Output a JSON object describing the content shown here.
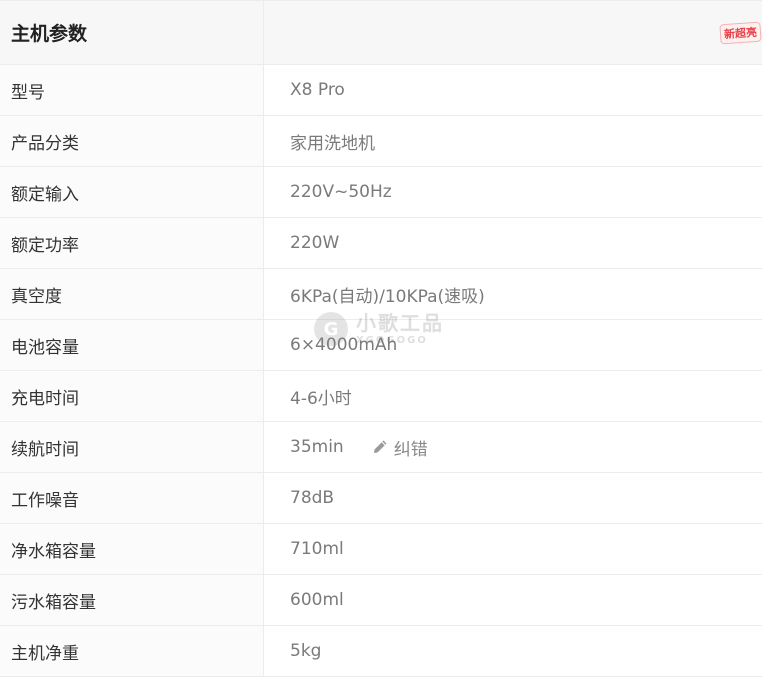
{
  "header": {
    "title": "主机参数",
    "badge": "新超亮"
  },
  "rows": [
    {
      "label": "型号",
      "value": "X8 Pro"
    },
    {
      "label": "产品分类",
      "value": "家用洗地机"
    },
    {
      "label": "额定输入",
      "value": "220V~50Hz"
    },
    {
      "label": "额定功率",
      "value": "220W"
    },
    {
      "label": "真空度",
      "value": "6KPa(自动)/10KPa(速吸)"
    },
    {
      "label": "电池容量",
      "value": "6×4000mAh"
    },
    {
      "label": "充电时间",
      "value": "4-6小时"
    },
    {
      "label": "续航时间",
      "value": "35min",
      "action": "纠错",
      "action_icon": "pencil-icon"
    },
    {
      "label": "工作噪音",
      "value": "78dB"
    },
    {
      "label": "净水箱容量",
      "value": "710ml"
    },
    {
      "label": "污水箱容量",
      "value": "600ml"
    },
    {
      "label": "主机净重",
      "value": "5kg"
    }
  ],
  "watermark": {
    "brand_cn": "小歌工品",
    "brand_en": "XGOGOGO",
    "logo_letter": "G"
  }
}
